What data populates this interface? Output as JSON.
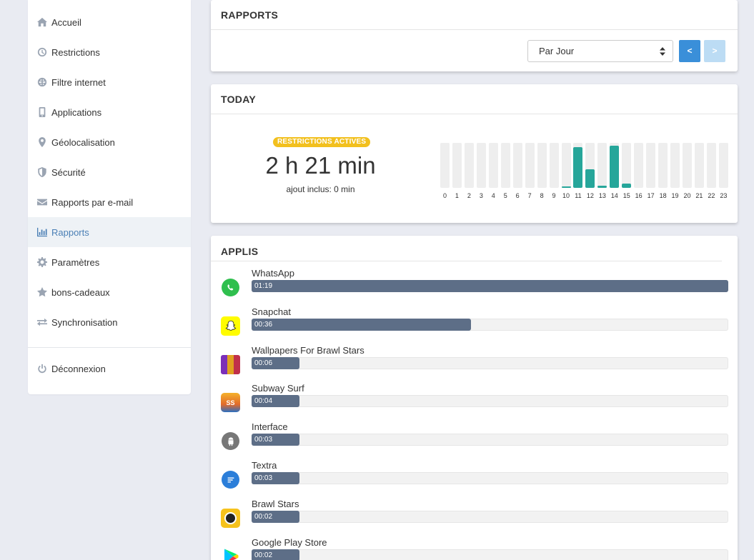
{
  "sidebar": {
    "items": [
      {
        "label": "Accueil",
        "icon": "home-icon"
      },
      {
        "label": "Restrictions",
        "icon": "clock-icon"
      },
      {
        "label": "Filtre internet",
        "icon": "globe-icon"
      },
      {
        "label": "Applications",
        "icon": "phone-icon"
      },
      {
        "label": "Géolocalisation",
        "icon": "map-pin-icon"
      },
      {
        "label": "Sécurité",
        "icon": "shield-icon"
      },
      {
        "label": "Rapports par e-mail",
        "icon": "envelope-icon"
      },
      {
        "label": "Rapports",
        "icon": "bar-chart-icon",
        "active": true
      },
      {
        "label": "Paramètres",
        "icon": "gear-icon"
      },
      {
        "label": "bons-cadeaux",
        "icon": "star-icon"
      },
      {
        "label": "Synchronisation",
        "icon": "sync-icon"
      }
    ],
    "logout_label": "Déconnexion"
  },
  "rapports": {
    "title": "RAPPORTS",
    "period_select": "Par Jour",
    "prev_label": "<",
    "next_label": ">"
  },
  "today": {
    "title": "TODAY",
    "badge": "RESTRICTIONS ACTIVES",
    "total_time": "2 h 21 min",
    "ajout": "ajout inclus: 0 min",
    "accent_color": "#26a69a",
    "hours": [
      {
        "h": "0",
        "v": 0
      },
      {
        "h": "1",
        "v": 0
      },
      {
        "h": "2",
        "v": 0
      },
      {
        "h": "3",
        "v": 0
      },
      {
        "h": "4",
        "v": 0
      },
      {
        "h": "5",
        "v": 0
      },
      {
        "h": "6",
        "v": 0
      },
      {
        "h": "7",
        "v": 0
      },
      {
        "h": "8",
        "v": 0
      },
      {
        "h": "9",
        "v": 0
      },
      {
        "h": "10",
        "v": 0.02
      },
      {
        "h": "11",
        "v": 0.9
      },
      {
        "h": "12",
        "v": 0.42
      },
      {
        "h": "13",
        "v": 0.05
      },
      {
        "h": "14",
        "v": 0.93
      },
      {
        "h": "15",
        "v": 0.09
      },
      {
        "h": "16",
        "v": 0
      },
      {
        "h": "17",
        "v": 0
      },
      {
        "h": "18",
        "v": 0
      },
      {
        "h": "19",
        "v": 0
      },
      {
        "h": "20",
        "v": 0
      },
      {
        "h": "21",
        "v": 0
      },
      {
        "h": "22",
        "v": 0
      },
      {
        "h": "23",
        "v": 0
      }
    ]
  },
  "applis": {
    "title": "APPLIS",
    "bar_color": "#5d6e87",
    "apps": [
      {
        "name": "WhatsApp",
        "time": "01:19",
        "fraction": 1.0,
        "icon": "whatsapp-icon"
      },
      {
        "name": "Snapchat",
        "time": "00:36",
        "fraction": 0.46,
        "icon": "snapchat-icon"
      },
      {
        "name": "Wallpapers For Brawl Stars",
        "time": "00:06",
        "fraction": 0.1,
        "icon": "wallpapers-icon"
      },
      {
        "name": "Subway Surf",
        "time": "00:04",
        "fraction": 0.1,
        "icon": "subway-surf-icon"
      },
      {
        "name": "Interface",
        "time": "00:03",
        "fraction": 0.1,
        "icon": "android-icon"
      },
      {
        "name": "Textra",
        "time": "00:03",
        "fraction": 0.1,
        "icon": "textra-icon"
      },
      {
        "name": "Brawl Stars",
        "time": "00:02",
        "fraction": 0.1,
        "icon": "brawl-stars-icon"
      },
      {
        "name": "Google Play Store",
        "time": "00:02",
        "fraction": 0.1,
        "icon": "play-store-icon"
      }
    ]
  }
}
